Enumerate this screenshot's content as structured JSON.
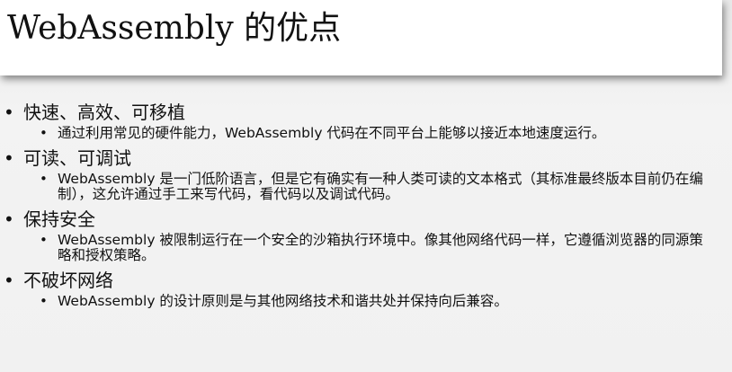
{
  "slide": {
    "title": "WebAssembly 的优点",
    "bullet_glyph": "•",
    "sections": [
      {
        "heading": "快速、高效、可移植",
        "detail": "通过利用常见的硬件能力，WebAssembly 代码在不同平台上能够以接近本地速度运行。"
      },
      {
        "heading": "可读、可调试",
        "detail": "WebAssembly 是一门低阶语言，但是它有确实有一种人类可读的文本格式（其标准最终版本目前仍在编制），这允许通过手工来写代码，看代码以及调试代码。"
      },
      {
        "heading": "保持安全",
        "detail": "WebAssembly 被限制运行在一个安全的沙箱执行环境中。像其他网络代码一样，它遵循浏览器的同源策略和授权策略。"
      },
      {
        "heading": "不破坏网络",
        "detail": "WebAssembly 的设计原则是与其他网络技术和谐共处并保持向后兼容。"
      }
    ]
  }
}
